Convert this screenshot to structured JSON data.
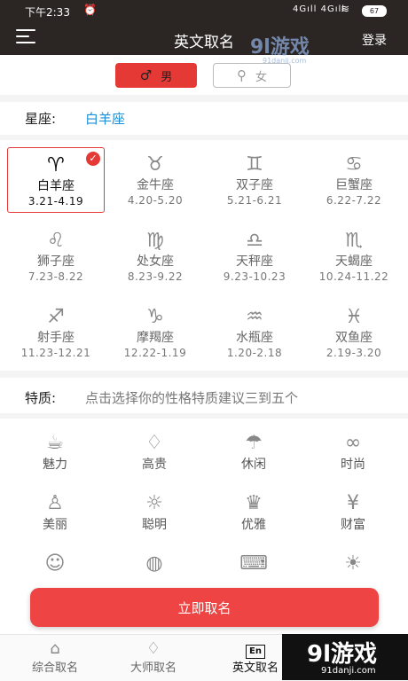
{
  "status": {
    "time": "下午2:33",
    "alarm_icon": "alarm-icon",
    "signal": "4Gıll 4Gıll",
    "battery": "67"
  },
  "header": {
    "title": "英文取名",
    "login": "登录",
    "menu_icon": "menu-icon"
  },
  "watermark_top": {
    "text": "9l游戏",
    "sub": "91danji.com"
  },
  "gender": {
    "male": "男",
    "female": "女",
    "selected": "male"
  },
  "constellation": {
    "label": "星座:",
    "value": "白羊座"
  },
  "zodiacs": [
    {
      "symbol": "♈",
      "name": "白羊座",
      "dates": "3.21-4.19",
      "selected": true
    },
    {
      "symbol": "♉",
      "name": "金牛座",
      "dates": "4.20-5.20"
    },
    {
      "symbol": "♊",
      "name": "双子座",
      "dates": "5.21-6.21"
    },
    {
      "symbol": "♋",
      "name": "巨蟹座",
      "dates": "6.22-7.22"
    },
    {
      "symbol": "♌",
      "name": "狮子座",
      "dates": "7.23-8.22"
    },
    {
      "symbol": "♍",
      "name": "处女座",
      "dates": "8.23-9.22"
    },
    {
      "symbol": "♎",
      "name": "天秤座",
      "dates": "9.23-10.23"
    },
    {
      "symbol": "♏",
      "name": "天蝎座",
      "dates": "10.24-11.22"
    },
    {
      "symbol": "♐",
      "name": "射手座",
      "dates": "11.23-12.21"
    },
    {
      "symbol": "♑",
      "name": "摩羯座",
      "dates": "12.22-1.19"
    },
    {
      "symbol": "♒",
      "name": "水瓶座",
      "dates": "1.20-2.18"
    },
    {
      "symbol": "♓",
      "name": "双鱼座",
      "dates": "2.19-3.20"
    }
  ],
  "traits_header": {
    "label": "特质:",
    "hint": "点击选择你的性格特质建议三到五个"
  },
  "traits": [
    {
      "icon": "☕",
      "name": "魅力"
    },
    {
      "icon": "♢",
      "name": "高贵"
    },
    {
      "icon": "☂",
      "name": "休闲"
    },
    {
      "icon": "∞",
      "name": "时尚"
    },
    {
      "icon": "♙",
      "name": "美丽"
    },
    {
      "icon": "☼",
      "name": "聪明"
    },
    {
      "icon": "♛",
      "name": "优雅"
    },
    {
      "icon": "¥",
      "name": "财富"
    },
    {
      "icon": "☺",
      "name": ""
    },
    {
      "icon": "◍",
      "name": ""
    },
    {
      "icon": "⌨",
      "name": ""
    },
    {
      "icon": "☀",
      "name": ""
    }
  ],
  "submit": "立即取名",
  "tabs": [
    {
      "icon": "⌂",
      "label": "综合取名"
    },
    {
      "icon": "♡",
      "label": "大师取名"
    },
    {
      "icon": "En",
      "label": "英文取名",
      "active": true
    }
  ],
  "watermark_bottom": {
    "text": "9l游戏",
    "sub": "91danji.com"
  },
  "colors": {
    "accent": "#e53935",
    "link": "#1c8fd6",
    "header_bg": "#2b2524"
  }
}
